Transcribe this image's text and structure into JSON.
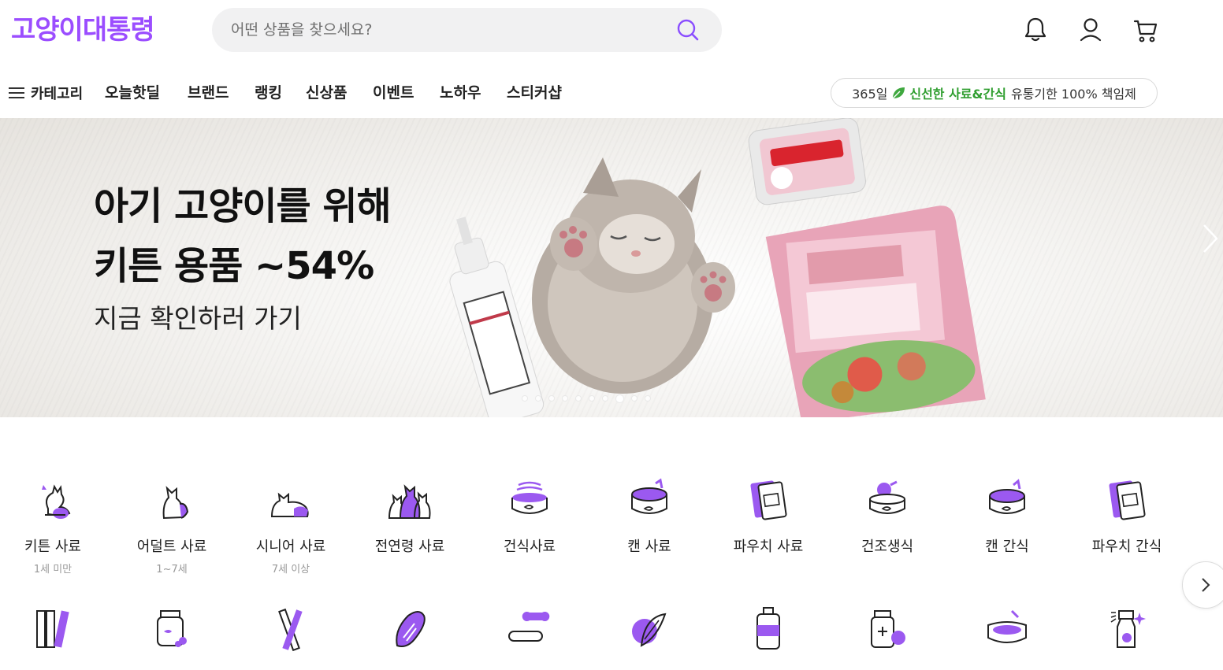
{
  "header": {
    "logo": "고양이대통령",
    "search_placeholder": "어떤 상품을 찾으세요?",
    "icons": [
      "bell-icon",
      "user-icon",
      "cart-icon"
    ]
  },
  "nav": {
    "category_label": "카테고리",
    "items": [
      "오늘핫딜",
      "브랜드",
      "랭킹",
      "신상품",
      "이벤트",
      "노하우",
      "스티커샵"
    ],
    "promo": {
      "prefix": "365일",
      "highlight": "신선한 사료&간식",
      "suffix": "유통기한 100% 책임제"
    }
  },
  "banner": {
    "title_line1": "아기 고양이를 위해",
    "title_line2": "키튼 용품 ~54%",
    "subtitle": "지금 확인하러 가기",
    "slide_count": 10,
    "active_slide": 8
  },
  "categories_row1": [
    {
      "label": "키튼 사료",
      "sub": "1세 미만",
      "icon": "kitten-icon"
    },
    {
      "label": "어덜트 사료",
      "sub": "1~7세",
      "icon": "adult-cat-icon"
    },
    {
      "label": "시니어 사료",
      "sub": "7세 이상",
      "icon": "senior-cat-icon"
    },
    {
      "label": "전연령 사료",
      "sub": "",
      "icon": "all-ages-cats-icon"
    },
    {
      "label": "건식사료",
      "sub": "",
      "icon": "dry-food-bowl-icon"
    },
    {
      "label": "캔 사료",
      "sub": "",
      "icon": "can-food-icon"
    },
    {
      "label": "파우치 사료",
      "sub": "",
      "icon": "pouch-food-icon"
    },
    {
      "label": "건조생식",
      "sub": "",
      "icon": "freeze-dried-icon"
    },
    {
      "label": "캔 간식",
      "sub": "",
      "icon": "can-snack-icon"
    },
    {
      "label": "파우치 간식",
      "sub": "",
      "icon": "pouch-snack-icon"
    }
  ],
  "categories_row2_icons": [
    "stick-snack-icon",
    "jar-snack-icon",
    "chew-stick-icon",
    "jerky-icon",
    "biscuit-icon",
    "cat-grass-icon",
    "supplement-bottle-icon",
    "medicine-icon",
    "bed-icon",
    "spray-bottle-icon"
  ],
  "colors": {
    "brand": "#9b4dff",
    "icon_purple": "#9b59f0",
    "promo_green": "#2f9e2f"
  }
}
